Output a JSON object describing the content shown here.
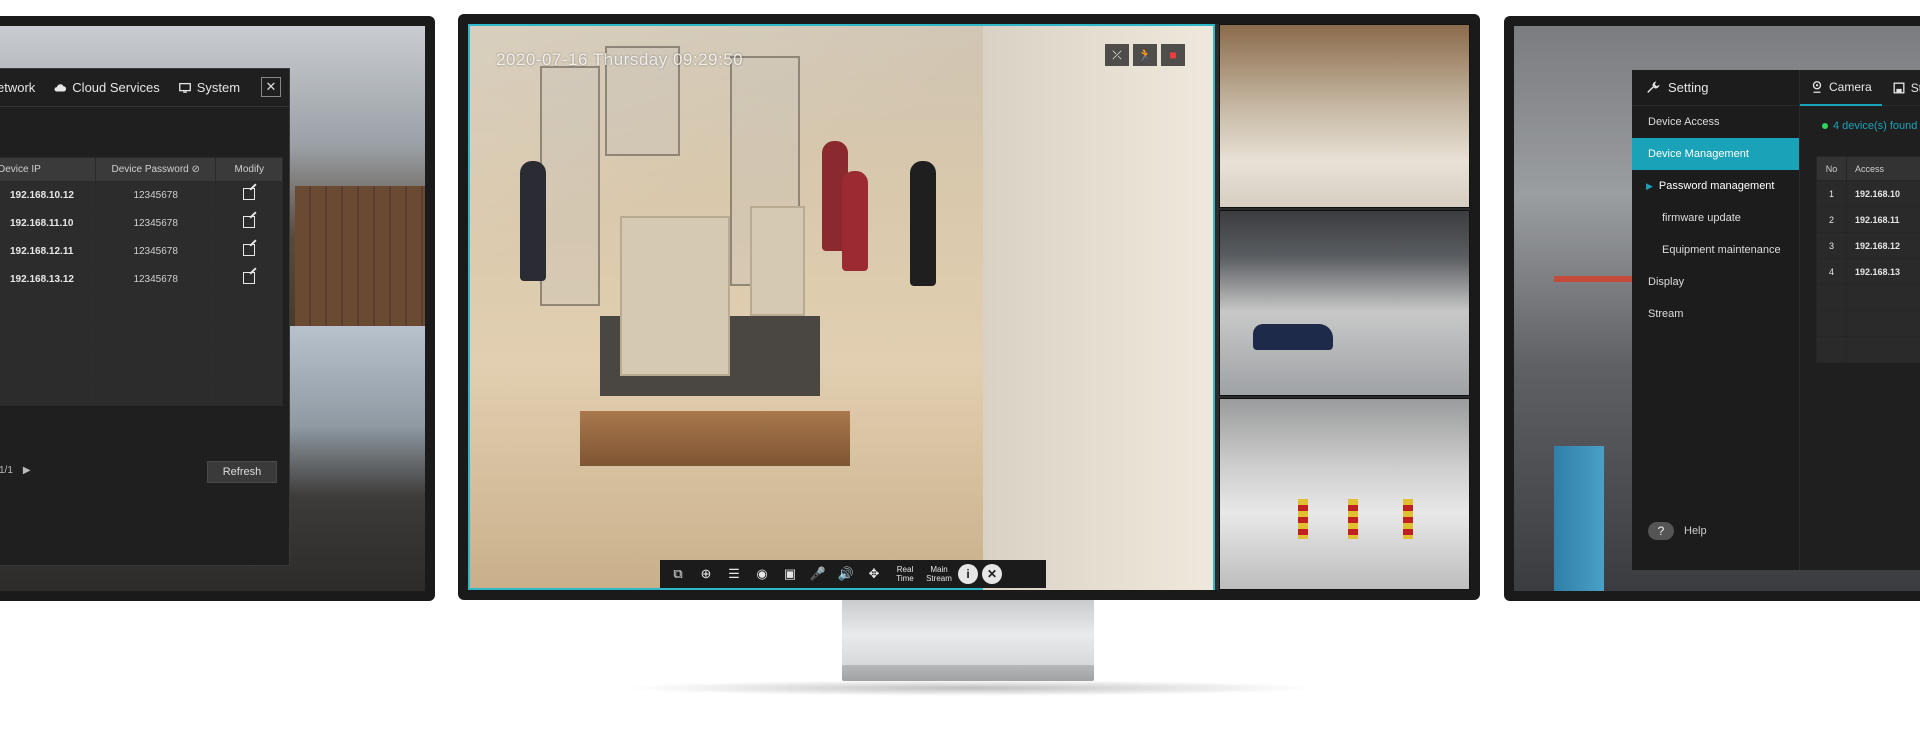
{
  "left_panel": {
    "tabs": [
      {
        "label": "etwork",
        "icon": "network-icon"
      },
      {
        "label": "Cloud Services",
        "icon": "cloud-icon"
      },
      {
        "label": "System",
        "icon": "monitor-icon"
      }
    ],
    "table": {
      "headers": {
        "ip": "Device IP",
        "password": "Device Password",
        "modify": "Modify"
      },
      "rows": [
        {
          "ip": "192.168.10.12",
          "password": "12345678"
        },
        {
          "ip": "192.168.11.10",
          "password": "12345678"
        },
        {
          "ip": "192.168.12.11",
          "password": "12345678"
        },
        {
          "ip": "192.168.13.12",
          "password": "12345678"
        }
      ]
    },
    "pagination": "1/1",
    "refresh_label": "Refresh"
  },
  "center": {
    "timestamp": "2020-07-16 Thursday 09:29:50",
    "toolbar": {
      "real_time": "Real\nTime",
      "main_stream": "Main\nStream"
    }
  },
  "right_panel": {
    "setting_label": "Setting",
    "menu": [
      {
        "label": "Device Access",
        "state": "normal"
      },
      {
        "label": "Device Management",
        "state": "active"
      },
      {
        "label": "Password management",
        "state": "sub-current"
      },
      {
        "label": "firmware update",
        "state": "sub"
      },
      {
        "label": "Equipment maintenance",
        "state": "sub"
      },
      {
        "label": "Display",
        "state": "normal"
      },
      {
        "label": "Stream",
        "state": "normal"
      }
    ],
    "help_label": "Help",
    "tabs": [
      {
        "label": "Camera",
        "icon": "camera-pin-icon"
      },
      {
        "label": "St",
        "icon": "save-icon"
      }
    ],
    "found_text": "4 device(s) found",
    "table": {
      "headers": {
        "no": "No",
        "access": "Access"
      },
      "rows": [
        {
          "no": "1",
          "ip": "192.168.10"
        },
        {
          "no": "2",
          "ip": "192.168.11"
        },
        {
          "no": "3",
          "ip": "192.168.12"
        },
        {
          "no": "4",
          "ip": "192.168.13"
        }
      ]
    }
  },
  "colors": {
    "accent": "#1aa3b8",
    "frame_border": "#2fb8c8"
  }
}
